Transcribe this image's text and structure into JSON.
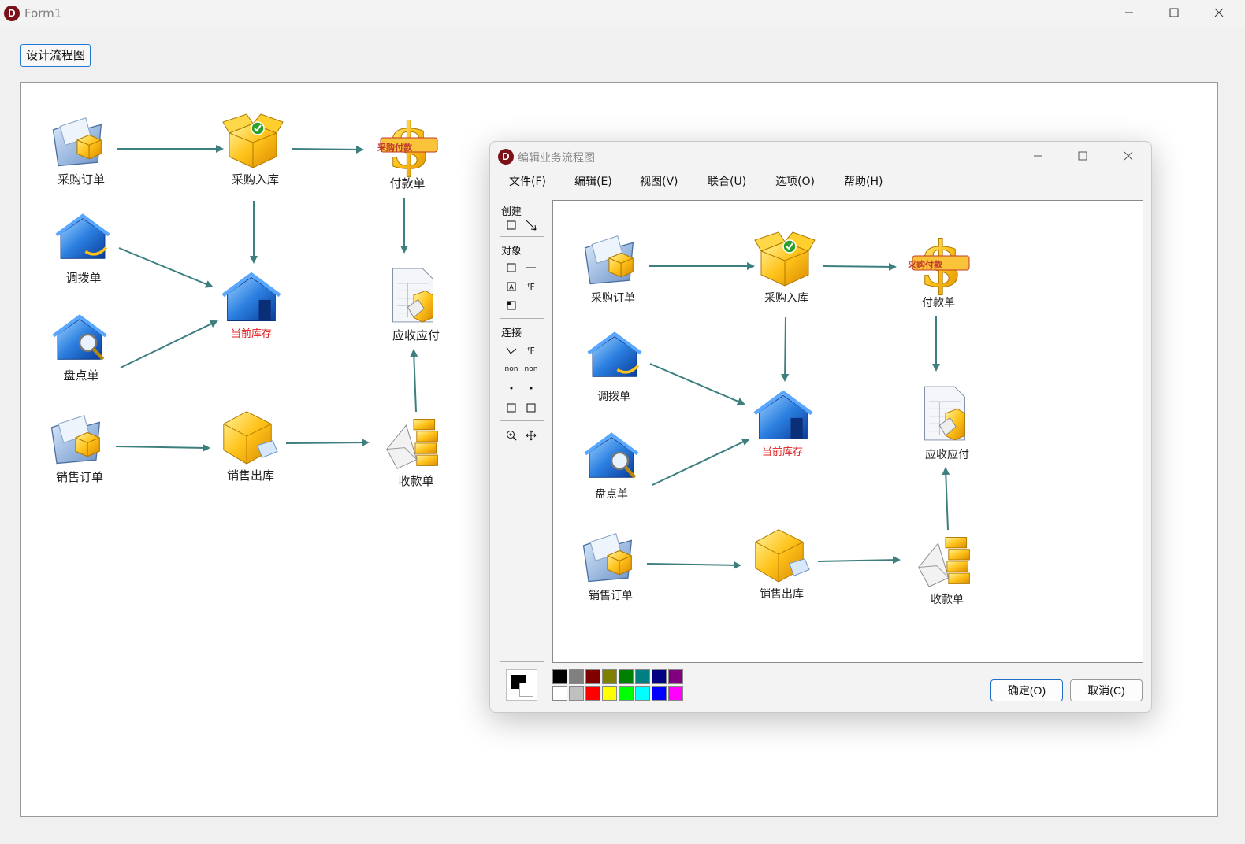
{
  "window": {
    "title": "Form1"
  },
  "toolbar": {
    "design_label": "设计流程图"
  },
  "flow": {
    "purchase_order": "采购订单",
    "purchase_in": "采购入库",
    "payment": "付款单",
    "payment_banner": "采购付款",
    "transfer": "调拨单",
    "inventory": "当前库存",
    "ar_ap": "应收应付",
    "stocktake": "盘点单",
    "sales_order": "销售订单",
    "sales_out": "销售出库",
    "receipt": "收款单"
  },
  "dialog": {
    "title": "编辑业务流程图",
    "menu": [
      "文件(F)",
      "编辑(E)",
      "视图(V)",
      "联合(U)",
      "选项(O)",
      "帮助(H)"
    ],
    "toolbox": {
      "create": "创建",
      "object": "对象",
      "connect": "连接",
      "f_glyph": "ᶠF",
      "non_label": "non"
    },
    "ok_label": "确定(O)",
    "cancel_label": "取消(C)",
    "palette_top": [
      "#000000",
      "#808080",
      "#800000",
      "#808000",
      "#008000",
      "#008080",
      "#000080",
      "#800080"
    ],
    "palette_bottom": [
      "#ffffff",
      "#c0c0c0",
      "#ff0000",
      "#ffff00",
      "#00ff00",
      "#00ffff",
      "#0000ff",
      "#ff00ff"
    ]
  },
  "colors": {
    "arrow": "#3d7f7e",
    "accent": "#1f7ad1",
    "danger": "#e02020"
  }
}
